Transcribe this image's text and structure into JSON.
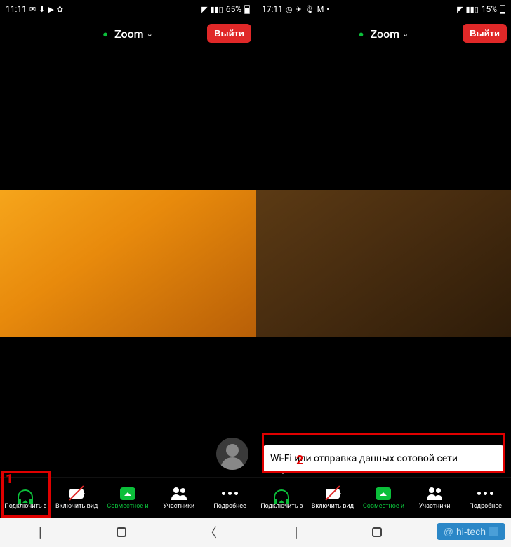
{
  "left": {
    "status": {
      "time": "11:11",
      "battery_pct": "65%",
      "battery_fill": 65
    },
    "header": {
      "title": "Zoom",
      "leave": "Выйти"
    },
    "toolbar": {
      "audio": "Подключить з",
      "video": "Включить вид",
      "share": "Совместное и",
      "participants": "Участники",
      "more": "Подробнее"
    },
    "annotation_number": "1"
  },
  "right": {
    "status": {
      "time": "17:11",
      "battery_pct": "15%",
      "battery_fill": 15
    },
    "header": {
      "title": "Zoom",
      "leave": "Выйти"
    },
    "tooltip": "Wi-Fi или отправка данных сотовой сети",
    "toolbar": {
      "audio": "Подключить з",
      "video": "Включить вид",
      "share": "Совместное и",
      "participants": "Участники",
      "more": "Подробнее"
    },
    "annotation_number": "2"
  },
  "watermark": {
    "at": "@",
    "text": "hi-tech"
  }
}
